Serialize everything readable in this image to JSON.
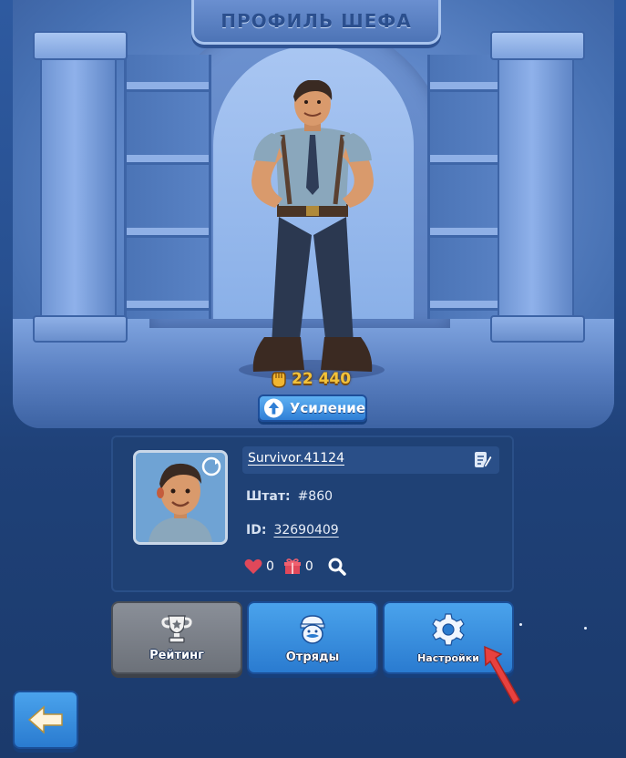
{
  "header": {
    "title": "ПРОФИЛЬ ШЕФА"
  },
  "character": {
    "power": "22 440"
  },
  "upgrade_button": {
    "label": "Усиление"
  },
  "profile": {
    "name": "Survivor.41124",
    "state_label": "Штат:",
    "state_value": "#860",
    "id_label": "ID:",
    "id_value": "32690409",
    "likes": "0",
    "gifts": "0"
  },
  "tabs": [
    {
      "label": "Рейтинг",
      "icon": "trophy-icon",
      "state": "disabled"
    },
    {
      "label": "Отряды",
      "icon": "squad-icon",
      "state": "active"
    },
    {
      "label": "Настройки",
      "icon": "gear-icon",
      "state": "active"
    }
  ],
  "colors": {
    "accent_blue": "#2f7fd6",
    "power_gold": "#f2c23a",
    "like_red": "#e0485a",
    "hint_arrow": "#e8413f"
  }
}
